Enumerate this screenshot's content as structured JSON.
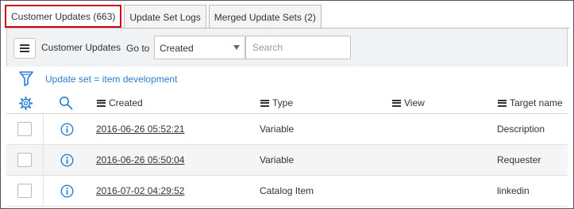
{
  "tabs": [
    {
      "label": "Customer Updates (663)",
      "active": true
    },
    {
      "label": "Update Set Logs",
      "active": false
    },
    {
      "label": "Merged Update Sets (2)",
      "active": false
    }
  ],
  "header": {
    "list_title": "Customer Updates",
    "goto_label": "Go to",
    "goto_selected": "Created",
    "search_placeholder": "Search"
  },
  "filter": {
    "breadcrumb": "Update set = item development"
  },
  "columns": {
    "created": "Created",
    "type": "Type",
    "view": "View",
    "target": "Target name"
  },
  "rows": [
    {
      "created": "2016-06-26 05:52:21",
      "type": "Variable",
      "view": "",
      "target": "Description"
    },
    {
      "created": "2016-06-26 05:50:04",
      "type": "Variable",
      "view": "",
      "target": "Requester"
    },
    {
      "created": "2016-07-02 04:29:52",
      "type": "Catalog Item",
      "view": "",
      "target": "linkedin"
    }
  ],
  "colors": {
    "active_tab_border": "#d0021b",
    "link_blue": "#2a7fd1",
    "header_bg": "#f0f2f3"
  },
  "icons": [
    "menu-icon",
    "caret-down-icon",
    "filter-icon",
    "gear-icon",
    "search-icon",
    "list-menu-icon",
    "info-icon"
  ]
}
